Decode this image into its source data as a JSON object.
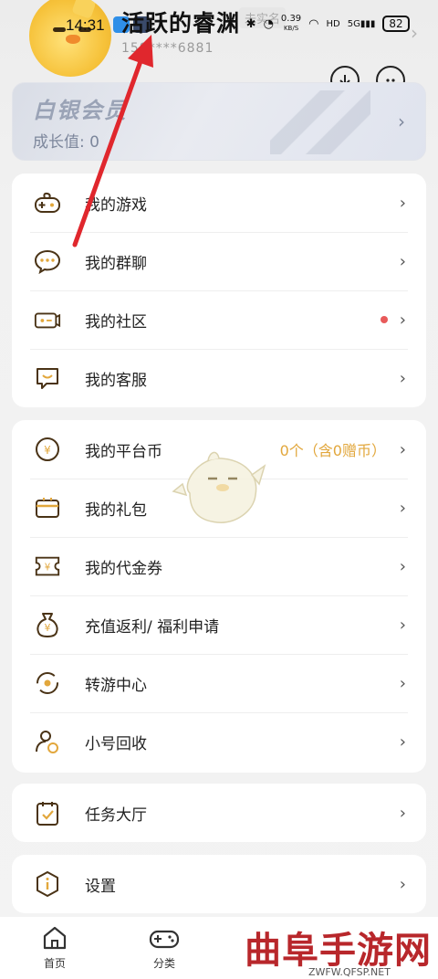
{
  "status_bar": {
    "time": "14:31",
    "network": "0.39",
    "network_unit": "KB/S",
    "hd": "HD",
    "signal": "5G",
    "battery": "82"
  },
  "profile": {
    "username": "活跃的睿渊",
    "phone": "159****6881",
    "verify_label": "未实名"
  },
  "member": {
    "title": "白银会员",
    "growth": "成长值: 0"
  },
  "group1": [
    {
      "label": "我的游戏",
      "icon": "gamepad-icon"
    },
    {
      "label": "我的群聊",
      "icon": "chat-bubble-icon"
    },
    {
      "label": "我的社区",
      "icon": "community-icon",
      "has_dot": true
    },
    {
      "label": "我的客服",
      "icon": "customer-service-icon"
    }
  ],
  "group2": [
    {
      "label": "我的平台币",
      "icon": "coin-icon",
      "value": "0个（含0赠币）"
    },
    {
      "label": "我的礼包",
      "icon": "gift-icon"
    },
    {
      "label": "我的代金券",
      "icon": "voucher-icon"
    },
    {
      "label": "充值返利/ 福利申请",
      "icon": "money-bag-icon"
    },
    {
      "label": "转游中心",
      "icon": "transfer-icon"
    },
    {
      "label": "小号回收",
      "icon": "account-recycle-icon"
    }
  ],
  "group3": [
    {
      "label": "任务大厅",
      "icon": "task-icon"
    }
  ],
  "group4": [
    {
      "label": "设置",
      "icon": "settings-icon"
    }
  ],
  "bottom_nav": [
    {
      "label": "首页",
      "icon": "home-icon"
    },
    {
      "label": "分类",
      "icon": "category-gamepad-icon"
    }
  ],
  "watermark": {
    "brand": "曲阜手游网",
    "url": "ZWFW.QFSP.NET"
  },
  "colors": {
    "accent_orange": "#d9993a",
    "red_dot": "#e85a5a",
    "arrow_red": "#e0272d"
  }
}
